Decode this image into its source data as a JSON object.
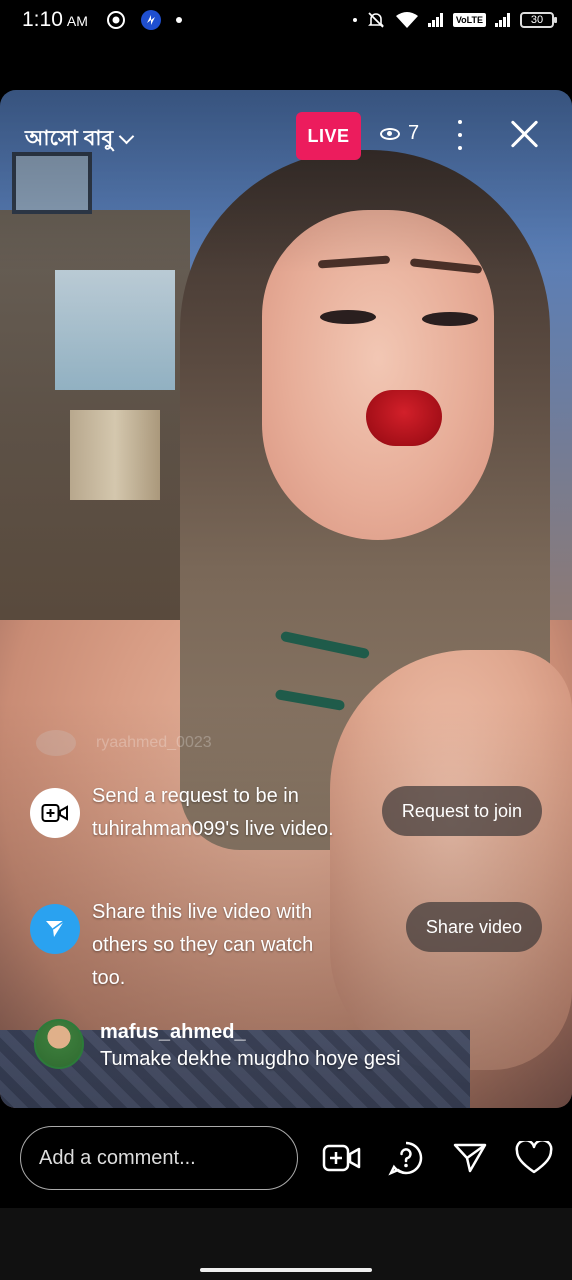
{
  "status_bar": {
    "time": "1:10",
    "ampm": "AM",
    "network": "VoLTE",
    "battery": "30",
    "icons": [
      "wifi-icon",
      "signal-icon",
      "mute-icon",
      "battery-icon"
    ]
  },
  "live": {
    "host_name": "আসো বাবু",
    "badge": "LIVE",
    "viewer_count": "7"
  },
  "faded_comment": {
    "text": "ryaahmed_0023"
  },
  "invites": [
    {
      "icon": "video-add-icon",
      "text": "Send a request to be in tuhirahman099's live video.",
      "button": "Request to join"
    },
    {
      "icon": "send-icon",
      "text": "Share this live video with others so they can watch too.",
      "button": "Share video"
    }
  ],
  "comment": {
    "username": "mafus_ahmed_",
    "text": "Tumake dekhe mugdho hoye gesi"
  },
  "bottom_bar": {
    "placeholder": "Add a comment...",
    "icons": [
      "add-video-icon",
      "question-icon",
      "send-icon",
      "heart-icon"
    ]
  },
  "colors": {
    "live_badge": "#ec1c5d",
    "share_icon_bg": "#2aa2f0"
  }
}
